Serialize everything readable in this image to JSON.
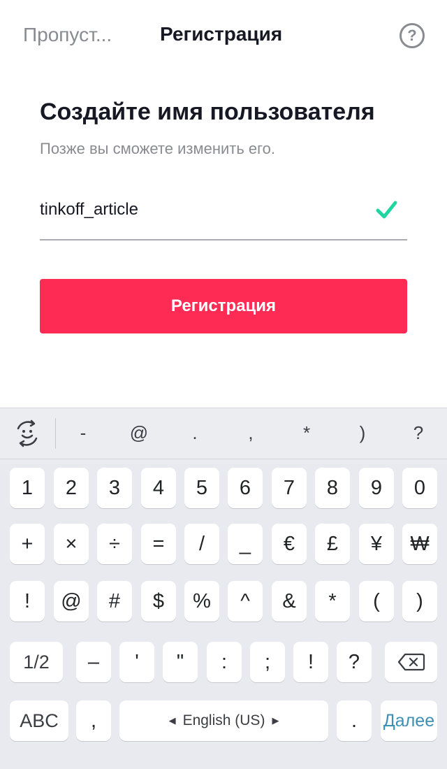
{
  "topbar": {
    "skip_label": "Пропуст...",
    "title": "Регистрация",
    "help_glyph": "?"
  },
  "form": {
    "heading": "Создайте имя пользователя",
    "subheading": "Позже вы сможете изменить его.",
    "username_value": "tinkoff_article",
    "valid_icon": "check-icon",
    "submit_label": "Регистрация"
  },
  "keyboard": {
    "suggestions": [
      "-",
      "@",
      ".",
      ",",
      "*",
      ")",
      "?"
    ],
    "rows": [
      [
        "1",
        "2",
        "3",
        "4",
        "5",
        "6",
        "7",
        "8",
        "9",
        "0"
      ],
      [
        "+",
        "×",
        "÷",
        "=",
        "/",
        "_",
        "€",
        "£",
        "¥",
        "₩"
      ],
      [
        "!",
        "@",
        "#",
        "$",
        "%",
        "^",
        "&",
        "*",
        "(",
        ")"
      ]
    ],
    "row4": {
      "shift_label": "1/2",
      "keys": [
        "–",
        "'",
        "\"",
        ":",
        ";",
        "!",
        "?"
      ],
      "backspace_icon": "backspace-icon"
    },
    "row5": {
      "abc_label": "ABC",
      "comma": ",",
      "space_label": "English (US)",
      "period": ".",
      "next_label": "Далее"
    }
  },
  "colors": {
    "accent": "#fe2c55",
    "check": "#20d5a0",
    "next_key": "#3d8fb6",
    "keyboard_bg": "#e9eaef"
  }
}
